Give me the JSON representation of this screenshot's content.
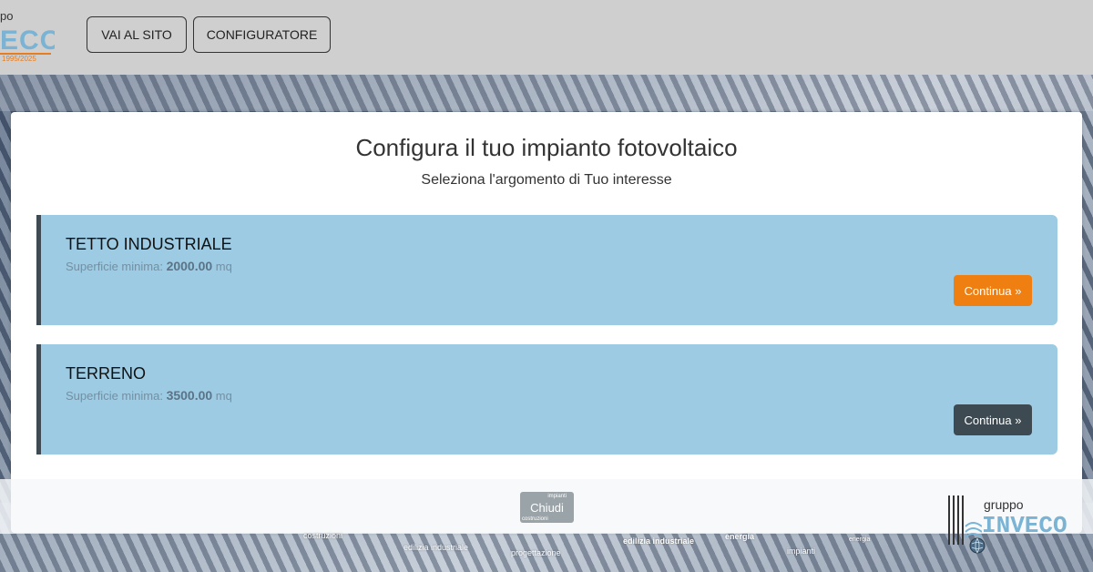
{
  "header": {
    "logo_top_line": "po",
    "logo_brand": "ECO",
    "logo_years": "1995/2025",
    "nav": [
      {
        "label": "VAI AL SITO"
      },
      {
        "label": "CONFIGURATORE"
      }
    ]
  },
  "main": {
    "title": "Configura il tuo impianto fotovoltaico",
    "subtitle": "Seleziona l'argomento di Tuo interesse",
    "options": [
      {
        "title": "TETTO INDUSTRIALE",
        "meta_label": "Superficie minima:",
        "meta_value": "2000.00",
        "meta_unit": "mq",
        "button": "Continua »",
        "button_color": "#f07f12"
      },
      {
        "title": "TERRENO",
        "meta_label": "Superficie minima:",
        "meta_value": "3500.00",
        "meta_unit": "mq",
        "button": "Continua »",
        "button_color": "#3e4a52"
      }
    ]
  },
  "footer": {
    "close_label": "Chiudi",
    "close_small_top": "impianti",
    "close_small_bottom": "costruzioni",
    "tags": [
      "costruzioni",
      "edilizia industriale",
      "progettazione",
      "edilizia industriale",
      "energia",
      "impianti",
      "energia"
    ],
    "logo_small": "gruppo",
    "logo_name": "INVECO"
  },
  "colors": {
    "topbar": "#cfcfcf",
    "option_bg": "#9ccbe3",
    "accent_orange": "#f07f12",
    "brand_blue": "#7ab3d3"
  }
}
